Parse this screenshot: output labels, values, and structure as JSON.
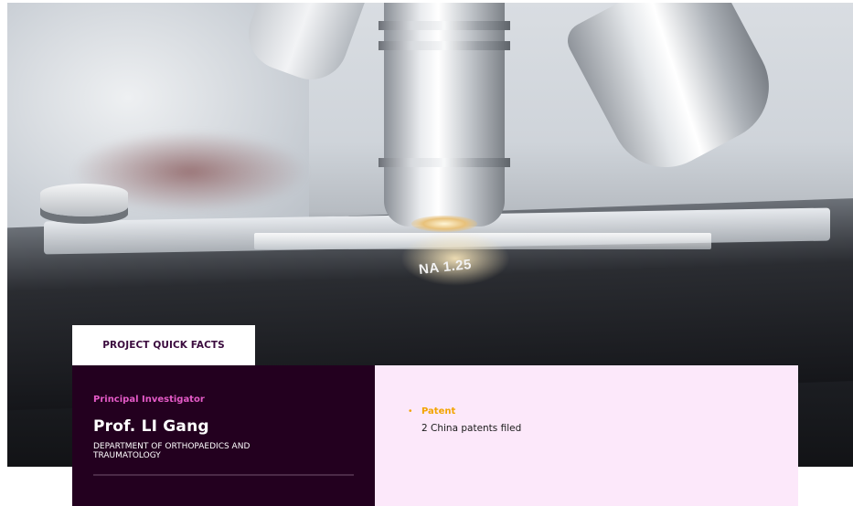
{
  "hero": {
    "image_subject": "microscope-photo-icon",
    "objective_label": "NA 1.25"
  },
  "tab": {
    "label": "PROJECT QUICK FACTS"
  },
  "investigator": {
    "label": "Principal Investigator",
    "name": "Prof. LI Gang",
    "department": "DEPARTMENT OF ORTHOPAEDICS AND TRAUMATOLOGY"
  },
  "facts": {
    "items": [
      {
        "title": "Patent",
        "description": "2 China patents filed"
      }
    ]
  },
  "colors": {
    "dark_panel": "#23001f",
    "pink_panel": "#fce8fa",
    "accent_magenta": "#e45ac7",
    "accent_orange": "#f2a400"
  }
}
